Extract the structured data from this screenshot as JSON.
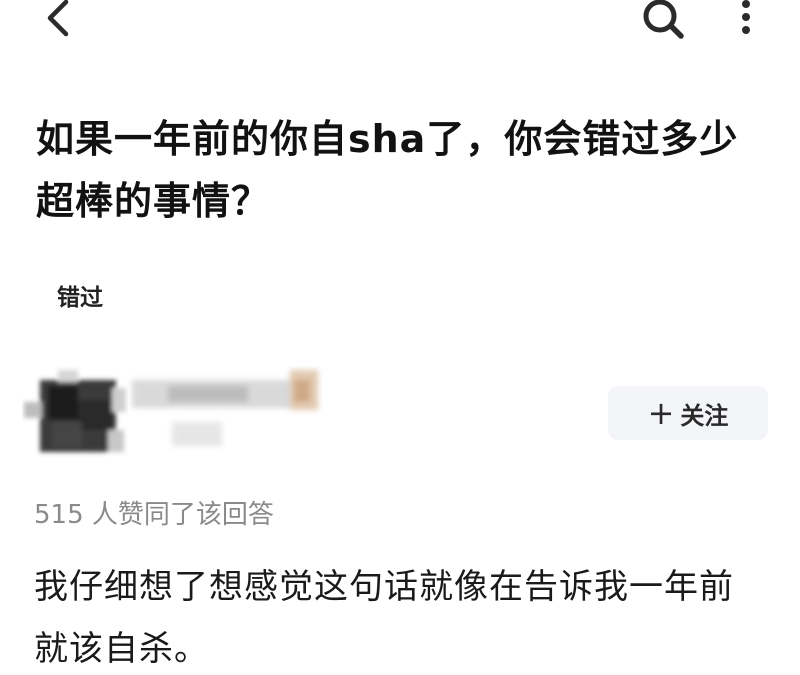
{
  "question": {
    "title": "如果一年前的你自sha了，你会错过多少超棒的事情？",
    "topic": "错过"
  },
  "author": {
    "follow_label": "关注",
    "follow_icon": "plus-icon"
  },
  "answer": {
    "vote_text": "515 人赞同了该回答",
    "body": "我仔细想了想感觉这句话就像在告诉我一年前就该自杀。"
  },
  "icons": {
    "back": "chevron-left-icon",
    "search": "search-icon",
    "more": "more-vertical-icon"
  },
  "colors": {
    "title": "#121212",
    "meta": "#8a8a8a",
    "follow_bg": "#f3f5f9"
  }
}
